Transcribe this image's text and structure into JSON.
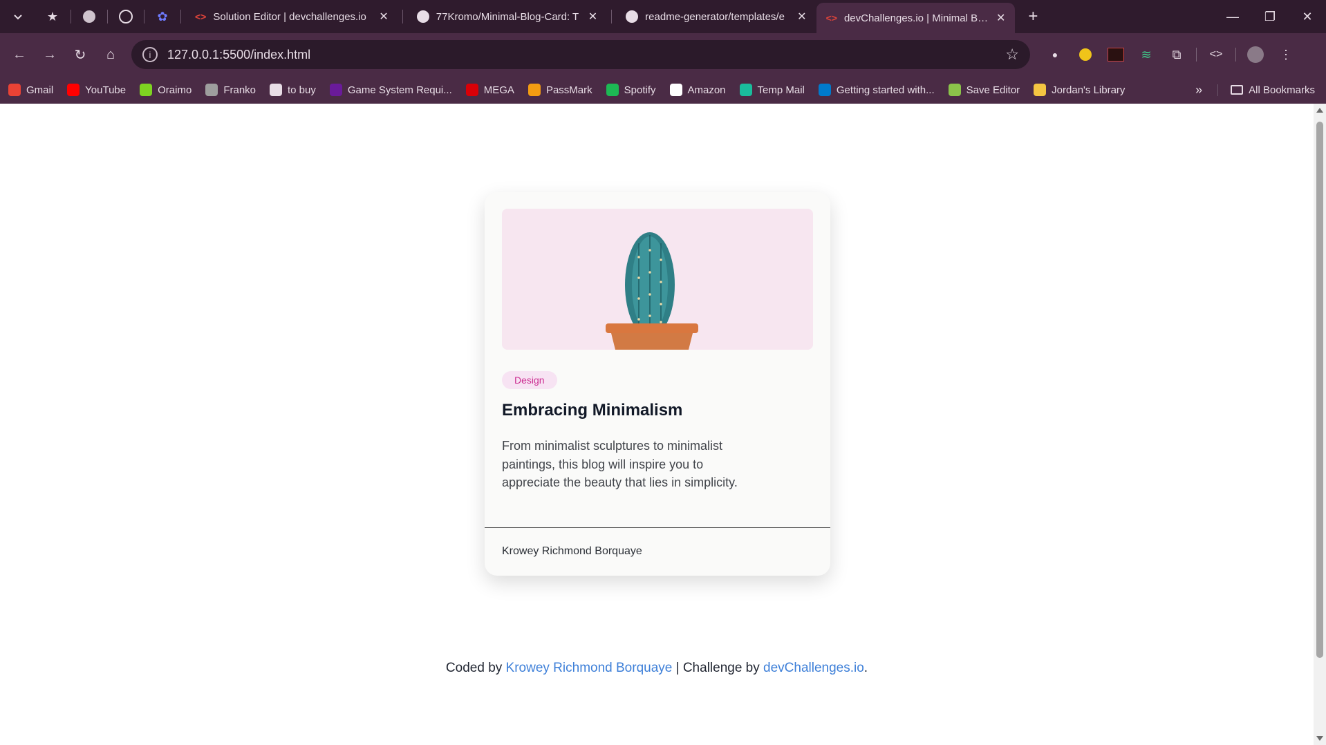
{
  "tabs": [
    {
      "title": "Solution Editor | devchallenges.io",
      "active": false
    },
    {
      "title": "77Kromo/Minimal-Blog-Card: T",
      "active": false
    },
    {
      "title": "readme-generator/templates/e",
      "active": false
    },
    {
      "title": "devChallenges.io | Minimal Blog",
      "active": true
    }
  ],
  "address_bar": {
    "url": "127.0.0.1:5500/index.html"
  },
  "bookmarks": [
    {
      "label": "Gmail",
      "color": "#ea4335"
    },
    {
      "label": "YouTube",
      "color": "#ff0000"
    },
    {
      "label": "Oraimo",
      "color": "#7ed321"
    },
    {
      "label": "Franko",
      "color": "#9e9e9e"
    },
    {
      "label": "to buy",
      "color": "#e8dde6"
    },
    {
      "label": "Game System Requi...",
      "color": "#6a1b9a"
    },
    {
      "label": "MEGA",
      "color": "#d90007"
    },
    {
      "label": "PassMark",
      "color": "#f39c12"
    },
    {
      "label": "Spotify",
      "color": "#1db954"
    },
    {
      "label": "Amazon",
      "color": "#ffffff"
    },
    {
      "label": "Temp Mail",
      "color": "#1abc9c"
    },
    {
      "label": "Getting started with...",
      "color": "#007acc"
    },
    {
      "label": "Save Editor",
      "color": "#8bc34a"
    },
    {
      "label": "Jordan's Library",
      "color": "#f4c542"
    }
  ],
  "bookmarks_all": "All Bookmarks",
  "card": {
    "tag": "Design",
    "title": "Embracing Minimalism",
    "description": "From minimalist sculptures to minimalist paintings, this blog will inspire you to appreciate the beauty that lies in simplicity.",
    "author": "Krowey Richmond Borquaye"
  },
  "attribution": {
    "prefix": "Coded by ",
    "author_link": "Krowey Richmond Borquaye",
    "middle": " | Challenge by ",
    "challenge_link": "devChallenges.io",
    "suffix": "."
  },
  "colors": {
    "accent": "#cc2f92",
    "link": "#3d7fd8",
    "chrome": "#4a2b45"
  }
}
